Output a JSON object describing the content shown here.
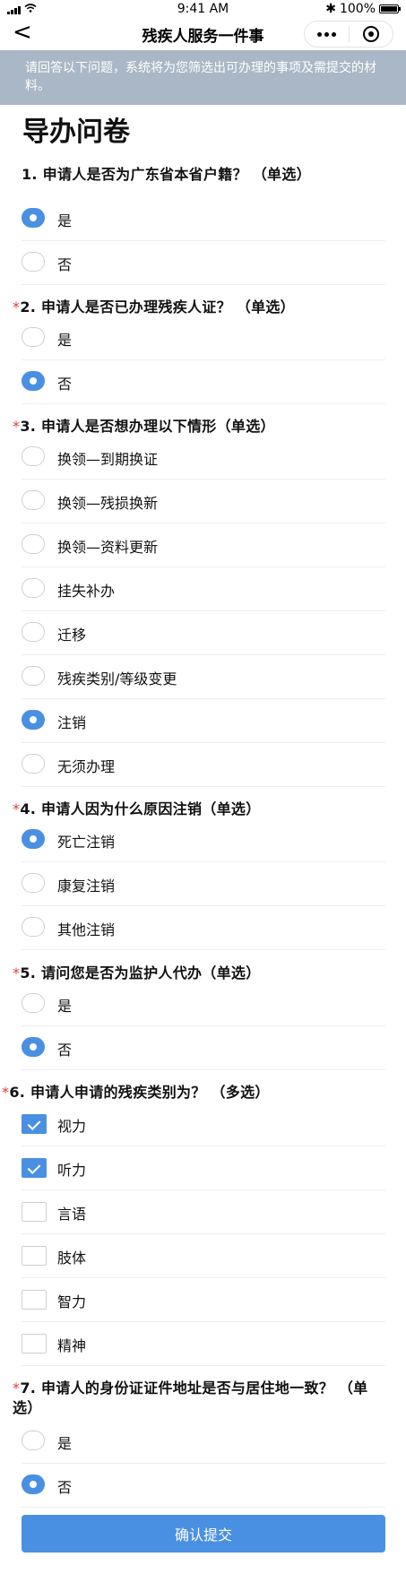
{
  "status_bar": {
    "time": "9:41 AM",
    "battery": "100%",
    "bluetooth": "✱"
  },
  "nav": {
    "back": "<",
    "title": "残疾人服务一件事"
  },
  "banner": {
    "text": "请回答以下问题，系统将为您筛选出可办理的事项及需提交的材料。"
  },
  "page_title": "导办问卷",
  "questions": [
    {
      "required": false,
      "title": "1. 申请人是否为广东省本省户籍？ （单选）",
      "type": "radio",
      "options": [
        {
          "label": "是",
          "selected": true
        },
        {
          "label": "否",
          "selected": false
        }
      ]
    },
    {
      "required": true,
      "title": "2. 申请人是否已办理残疾人证？ （单选）",
      "type": "radio",
      "options": [
        {
          "label": "是",
          "selected": false
        },
        {
          "label": "否",
          "selected": true
        }
      ]
    },
    {
      "required": true,
      "title": "3. 申请人是否想办理以下情形（单选）",
      "type": "radio",
      "options": [
        {
          "label": "换领—到期换证",
          "selected": false
        },
        {
          "label": "换领—残损换新",
          "selected": false
        },
        {
          "label": "换领—资料更新",
          "selected": false
        },
        {
          "label": "挂失补办",
          "selected": false
        },
        {
          "label": "迁移",
          "selected": false
        },
        {
          "label": "残疾类别/等级变更",
          "selected": false
        },
        {
          "label": "注销",
          "selected": true
        },
        {
          "label": "无须办理",
          "selected": false
        }
      ]
    },
    {
      "required": true,
      "title": "4. 申请人因为什么原因注销（单选）",
      "type": "radio",
      "options": [
        {
          "label": "死亡注销",
          "selected": true
        },
        {
          "label": "康复注销",
          "selected": false
        },
        {
          "label": "其他注销",
          "selected": false
        }
      ]
    },
    {
      "required": true,
      "title": "5. 请问您是否为监护人代办（单选）",
      "type": "radio",
      "options": [
        {
          "label": "是",
          "selected": false
        },
        {
          "label": "否",
          "selected": true
        }
      ]
    },
    {
      "required": true,
      "title": "6. 申请人申请的残疾类别为？ （多选）",
      "type": "checkbox",
      "options": [
        {
          "label": "视力",
          "selected": true
        },
        {
          "label": "听力",
          "selected": true
        },
        {
          "label": "言语",
          "selected": false
        },
        {
          "label": "肢体",
          "selected": false
        },
        {
          "label": "智力",
          "selected": false
        },
        {
          "label": "精神",
          "selected": false
        }
      ]
    },
    {
      "required": true,
      "title": "7. 申请人的身份证证件地址是否与居住地一致？ （单选）",
      "type": "radio",
      "options": [
        {
          "label": "是",
          "selected": false
        },
        {
          "label": "否",
          "selected": true
        }
      ]
    }
  ],
  "submit_label": "确认提交",
  "colors": {
    "accent": "#4a90e2",
    "banner": "#aab7c6",
    "required": "#e23b3b"
  }
}
